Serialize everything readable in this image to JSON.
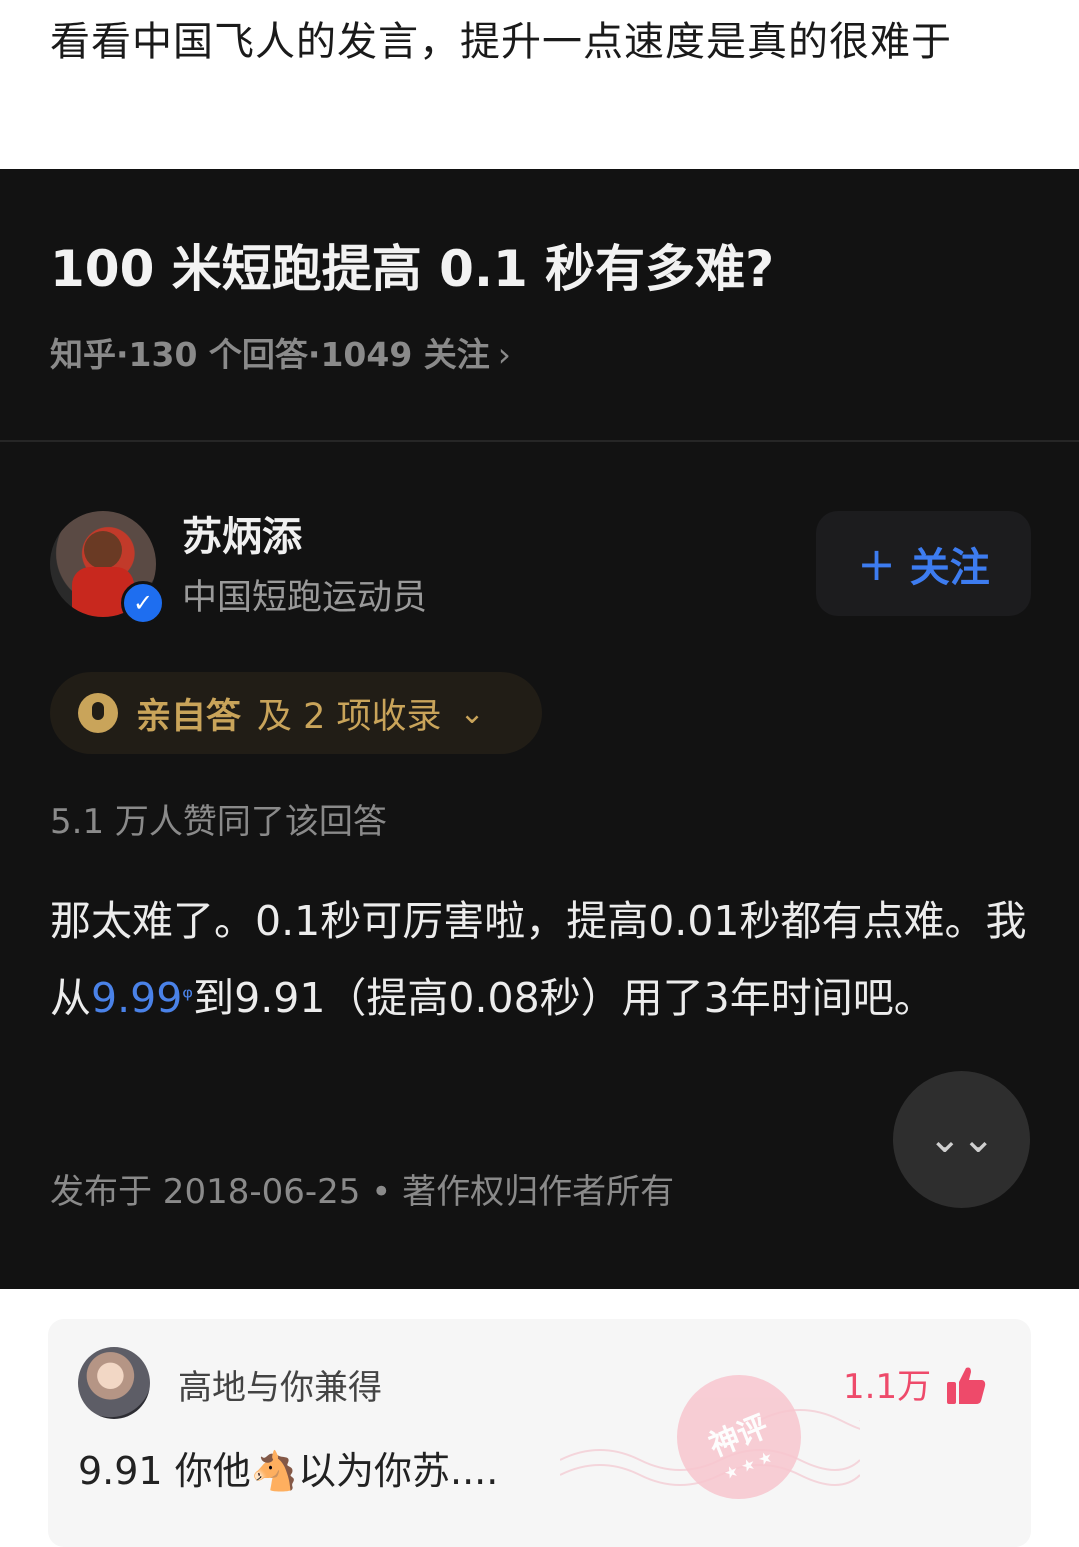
{
  "post": {
    "caption": "看看中国飞人的发言，提升一点速度是真的很难于"
  },
  "question": {
    "title": "100 米短跑提高 0.1 秒有多难?",
    "meta": "知乎·130 个回答·1049 关注",
    "meta_chevron": "›"
  },
  "author": {
    "name": "苏炳添",
    "title": "中国短跑运动员",
    "follow_plus": "+",
    "follow_label": "关注",
    "verified_mark": "✓"
  },
  "badge": {
    "strong": "亲自答",
    "rest": "及 2 项收录",
    "chevron": "⌄"
  },
  "answer": {
    "likes": "5.1 万人赞同了该回答",
    "text_1": "那太难了。0.1秒可厉害啦，提高0.01秒都有点难。我从",
    "link": "9.99",
    "link_mark": "ᵠ",
    "text_2": "到9.91（提高0.08秒）用了3年时间吧。",
    "published": "发布于 2018-06-25 • 著作权归作者所有"
  },
  "scroll_button": {
    "icon": "double-chevron-down-icon",
    "glyph": "⌄⌄"
  },
  "comment": {
    "username": "高地与你兼得",
    "text": "9.91 你他🐴以为你苏....",
    "likes": "1.1万",
    "stamp": "神评",
    "stamp_stars": "★★★"
  },
  "colors": {
    "dark_bg": "#121212",
    "link_blue": "#4a82e8",
    "follow_blue": "#3d7cf0",
    "badge_gold": "#c9a45a",
    "like_pink": "#ee4a6a"
  }
}
